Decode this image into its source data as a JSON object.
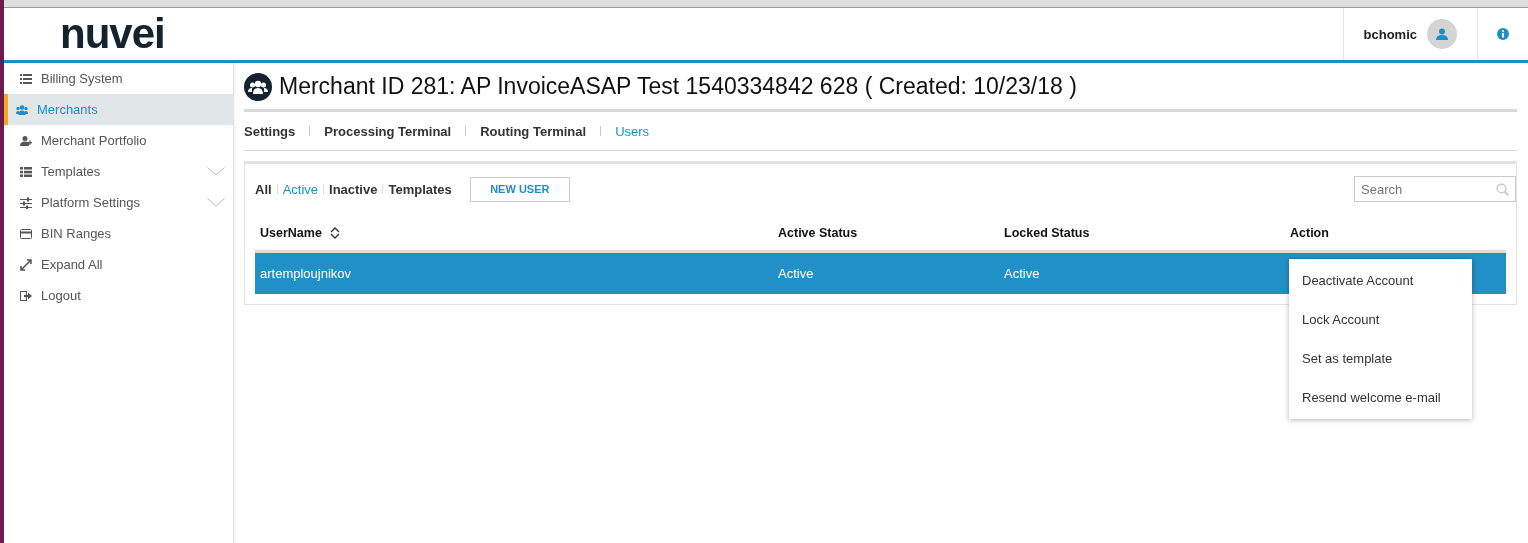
{
  "header": {
    "logo": "nuvei",
    "user": "bchomic"
  },
  "sidebar": {
    "items": [
      {
        "label": "Billing System",
        "selected": false,
        "expandable": false
      },
      {
        "label": "Merchants",
        "selected": true,
        "expandable": false
      },
      {
        "label": "Merchant Portfolio",
        "selected": false,
        "expandable": false
      },
      {
        "label": "Templates",
        "selected": false,
        "expandable": true
      },
      {
        "label": "Platform Settings",
        "selected": false,
        "expandable": true
      },
      {
        "label": "BIN Ranges",
        "selected": false,
        "expandable": false
      },
      {
        "label": "Expand All",
        "selected": false,
        "expandable": false
      },
      {
        "label": "Logout",
        "selected": false,
        "expandable": false
      }
    ]
  },
  "page": {
    "title": "Merchant ID 281: AP InvoiceASAP Test 1540334842 628 ( Created: 10/23/18 )",
    "tabs": [
      {
        "label": "Settings",
        "selected": false
      },
      {
        "label": "Processing Terminal",
        "selected": false
      },
      {
        "label": "Routing Terminal",
        "selected": false
      },
      {
        "label": "Users",
        "selected": true
      }
    ]
  },
  "users": {
    "filters": [
      {
        "label": "All",
        "selected": false
      },
      {
        "label": "Active",
        "selected": true
      },
      {
        "label": "Inactive",
        "selected": false
      },
      {
        "label": "Templates",
        "selected": false
      }
    ],
    "new_button": "NEW USER",
    "search": {
      "placeholder": "Search"
    },
    "columns": [
      "UserName",
      "Active Status",
      "Locked Status",
      "Action"
    ],
    "rows": [
      {
        "cells": [
          "artemploujnikov",
          "Active",
          "Active"
        ],
        "selected": true
      }
    ],
    "action_menu": [
      "Deactivate Account",
      "Lock Account",
      "Set as template",
      "Resend welcome e-mail"
    ]
  }
}
